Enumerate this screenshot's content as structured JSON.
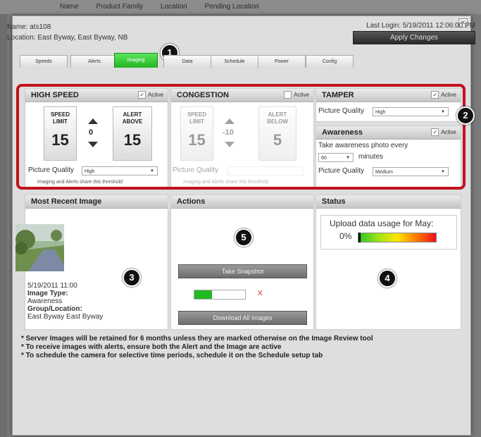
{
  "background": {
    "columns": [
      "Name",
      "Product Family",
      "Location",
      "Pending Location"
    ]
  },
  "info": {
    "name_line": "Name:  ats108",
    "location_line": "Location:  East Byway, East Byway, NB",
    "last_login": "Last Login: 5/19/2011 12:06:00 PM",
    "apply_label": "Apply Changes"
  },
  "tabs": [
    "Speeds",
    "Alerts",
    "Imaging",
    "Data",
    "Schedule",
    "Power",
    "Config"
  ],
  "active_tab": "Imaging",
  "callouts": [
    "1",
    "2",
    "3",
    "4",
    "5"
  ],
  "high_speed": {
    "title": "HIGH SPEED",
    "active_label": "Active",
    "active": true,
    "limit_label_1": "SPEED",
    "limit_label_2": "LIMIT",
    "limit_value": "15",
    "offset": "0",
    "alert_label_1": "ALERT",
    "alert_label_2": "ABOVE",
    "alert_value": "15",
    "pq_label": "Picture Quality",
    "pq_value": "High",
    "note": "Imaging and Alerts share this threshold"
  },
  "congestion": {
    "title": "CONGESTION",
    "active_label": "Active",
    "active": false,
    "limit_label_1": "SPEED",
    "limit_label_2": "LIMIT",
    "limit_value": "15",
    "offset": "-10",
    "alert_label_1": "ALERT",
    "alert_label_2": "BELOW",
    "alert_value": "5",
    "pq_label": "Picture Quality",
    "note": "Imaging and Alerts share this threshold"
  },
  "tamper": {
    "title": "TAMPER",
    "active_label": "Active",
    "active": true,
    "pq_label": "Picture Quality",
    "pq_value": "High"
  },
  "awareness": {
    "title": "Awareness",
    "active_label": "Active",
    "active": true,
    "take_label": "Take awareness photo every",
    "interval_value": "60",
    "minutes_label": "minutes",
    "pq_label": "Picture Quality",
    "pq_value": "Medium"
  },
  "recent": {
    "title": "Most Recent Image",
    "timestamp": "5/19/2011 11:00",
    "image_type_label": "Image Type:",
    "image_type": "Awareness",
    "group_label": "Group/Location:",
    "group_value": "East Byway East Byway"
  },
  "actions": {
    "title": "Actions",
    "snapshot_label": "Take Snapshot",
    "download_label": "Download All Images",
    "progress": 0.35,
    "x_mark": "X"
  },
  "status": {
    "title": "Status",
    "upload_label": "Upload data usage for May:",
    "percent": "0%",
    "usage": 0
  },
  "footnotes": [
    "* Server Images will be retained for 6 months unless they are marked otherwise on the Image Review tool",
    "* To receive images with alerts, ensure both the Alert and the Image are active",
    "* To schedule the camera for selective time periods, schedule it on the Schedule setup tab"
  ],
  "colors": {
    "highlight_red": "#c1121c",
    "active_tab_green": "#21b521"
  }
}
